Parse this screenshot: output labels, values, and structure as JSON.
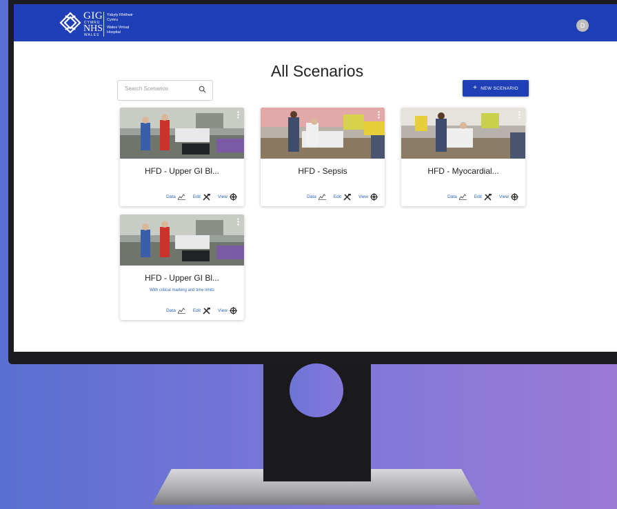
{
  "header": {
    "logo": {
      "gig": "GIG",
      "cymru": "CYMRU",
      "nhs": "NHS",
      "wales": "WALES"
    },
    "org_lines": [
      "Ysbyty Rhithwir",
      "Cymru",
      "Wales Virtual",
      "Hospital"
    ],
    "avatar_initial": "D",
    "color": "#1e3fb5"
  },
  "page": {
    "title": "All Scenarios",
    "search_placeholder": "Search Scenarios",
    "new_button_label": "NEW SCENARIO"
  },
  "cards": [
    {
      "title": "HFD - Upper GI Bl...",
      "subtitle": "",
      "image": "ward-scene-a",
      "actions": {
        "data": "Data",
        "edit": "Edit",
        "view": "View"
      }
    },
    {
      "title": "HFD - Sepsis",
      "subtitle": "",
      "image": "ward-scene-b",
      "actions": {
        "data": "Data",
        "edit": "Edit",
        "view": "View"
      }
    },
    {
      "title": "HFD - Myocardial...",
      "subtitle": "",
      "image": "ward-scene-c",
      "actions": {
        "data": "Data",
        "edit": "Edit",
        "view": "View"
      }
    },
    {
      "title": "HFD - Upper GI Bl...",
      "subtitle": "With critical marking and time limits",
      "image": "ward-scene-a",
      "actions": {
        "data": "Data",
        "edit": "Edit",
        "view": "View"
      }
    }
  ],
  "icons": {
    "search": "search-icon",
    "data": "chart-icon",
    "edit": "tools-icon",
    "view": "vr-icon",
    "menu": "kebab-menu-icon"
  }
}
